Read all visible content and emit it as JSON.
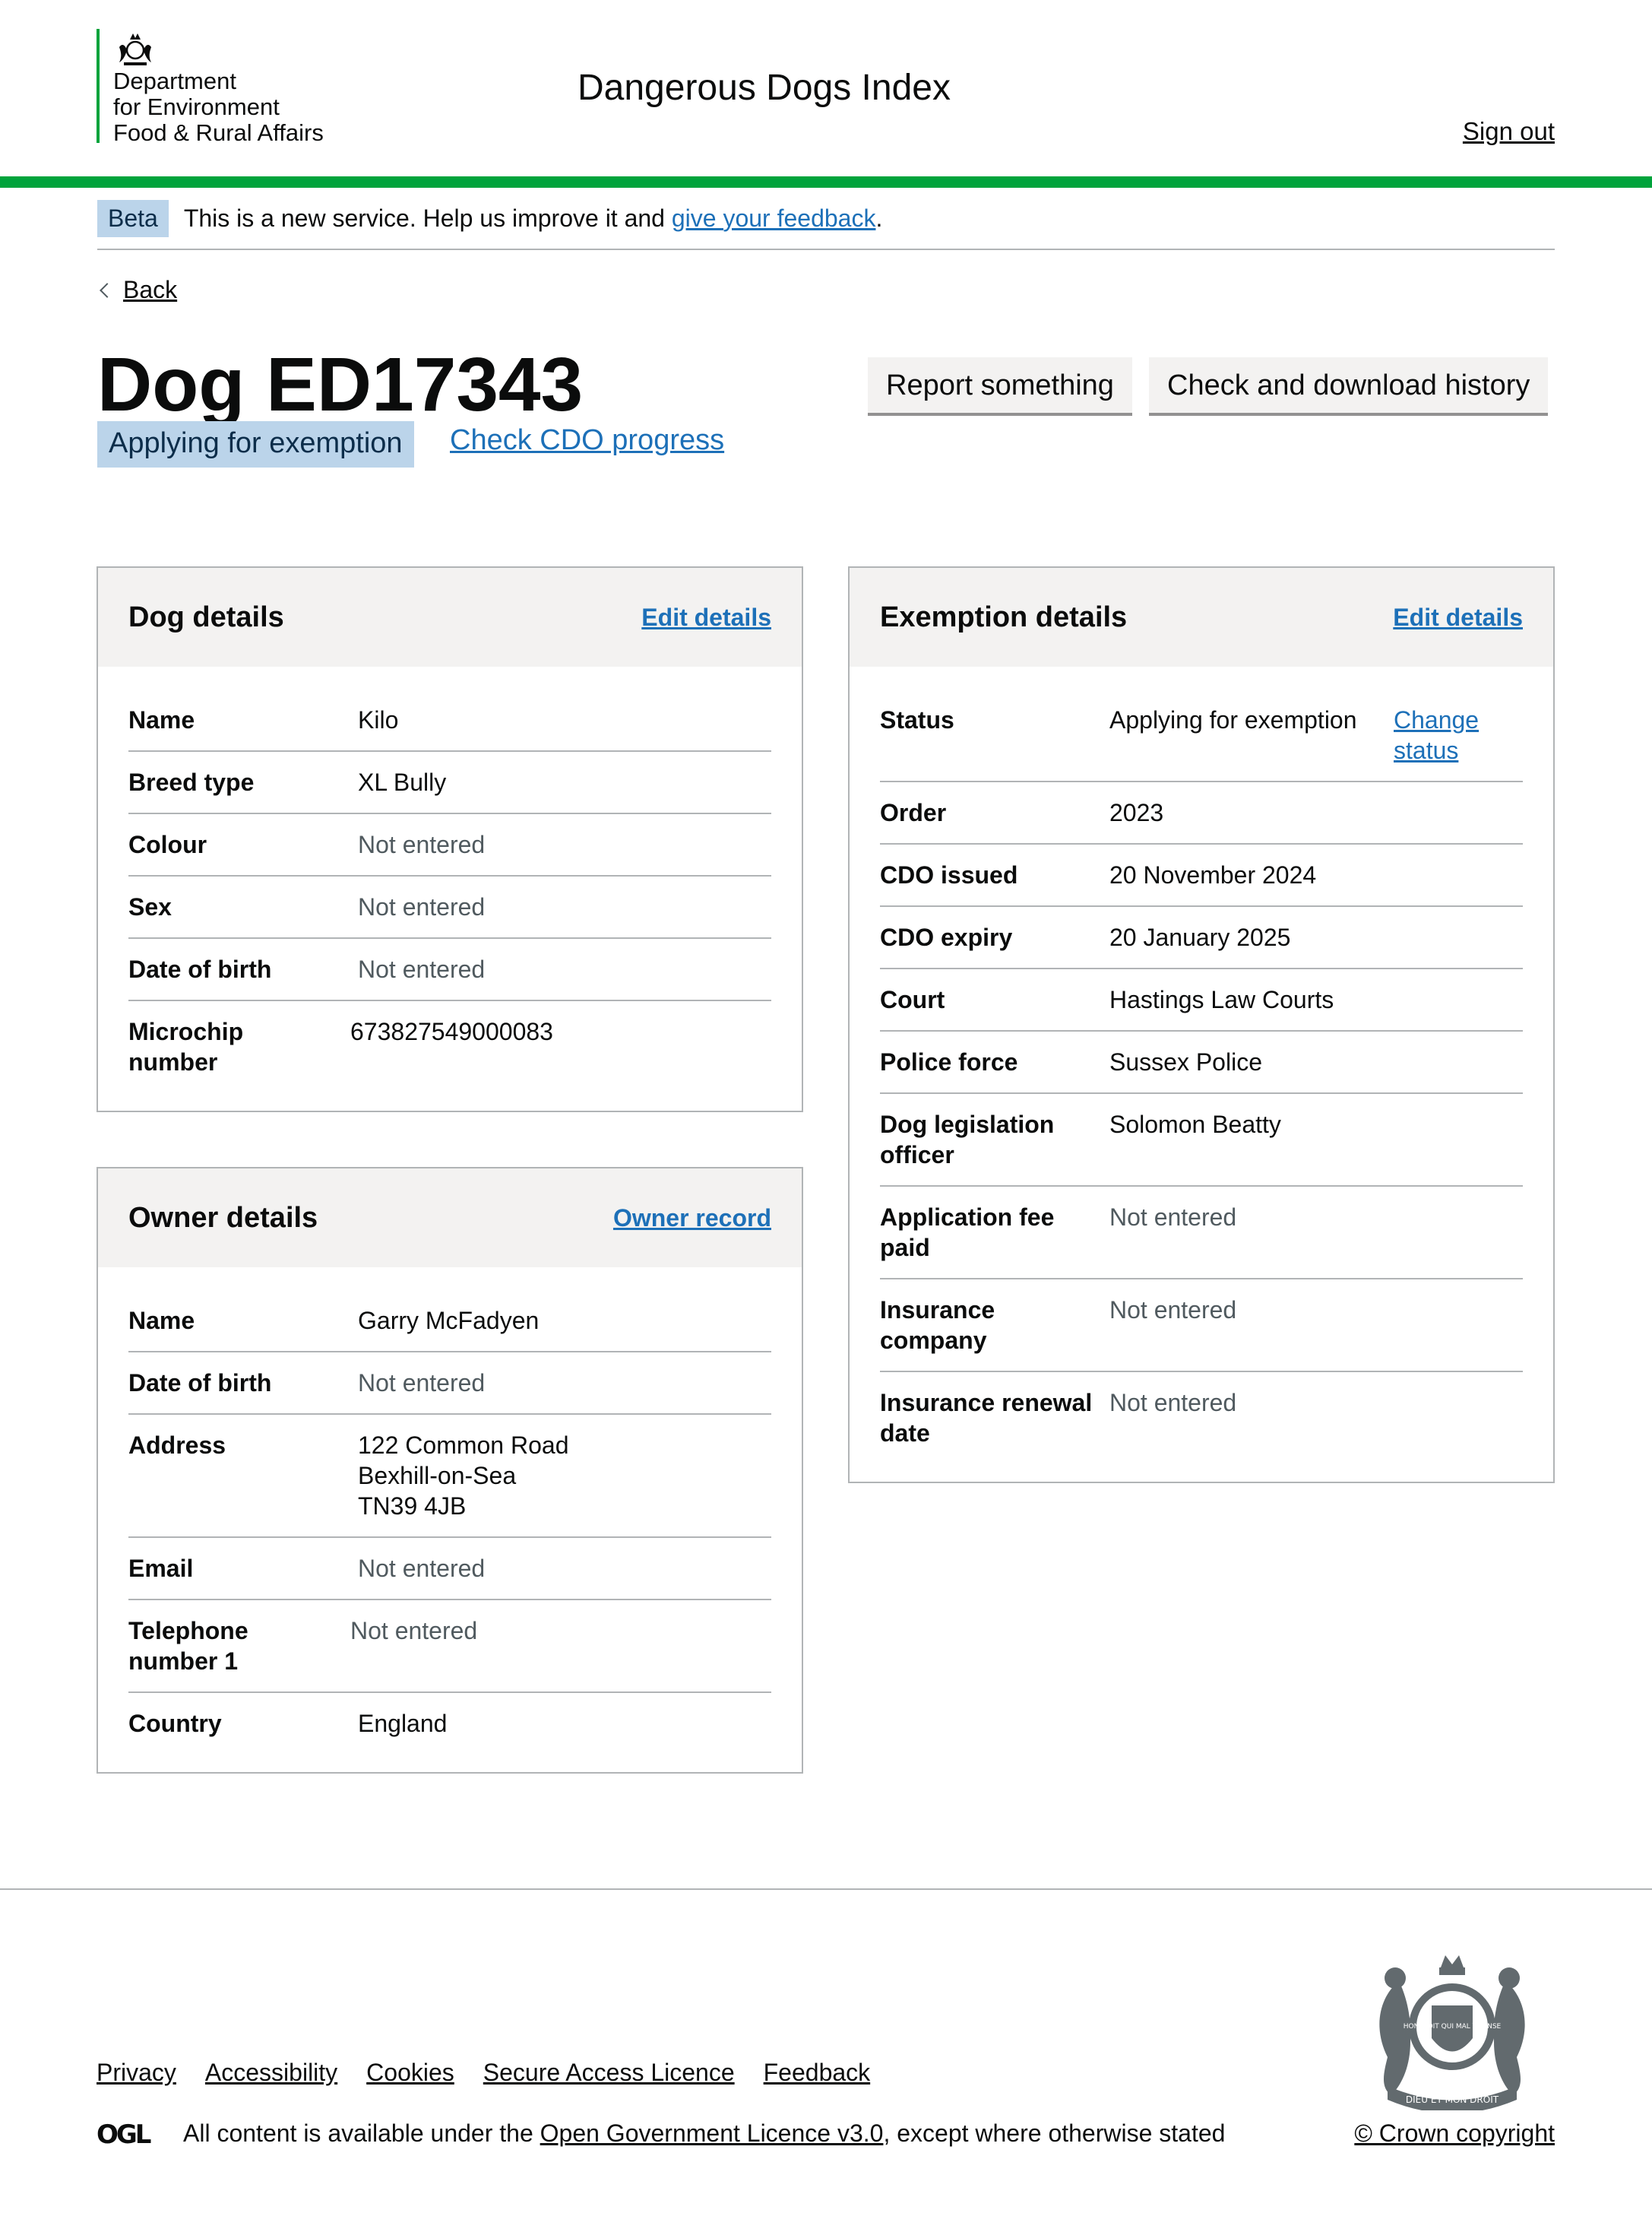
{
  "header": {
    "org_name_line1": "Department",
    "org_name_line2": "for Environment",
    "org_name_line3": "Food & Rural Affairs",
    "service_name": "Dangerous Dogs Index",
    "sign_out": "Sign out"
  },
  "beta": {
    "tag": "Beta",
    "text_before": "This is a new service. Help us improve it and ",
    "link": "give your feedback",
    "text_after": "."
  },
  "back_link": "Back",
  "page": {
    "title": "Dog ED17343",
    "status_tag": "Applying for exemption",
    "check_cdo_link": "Check CDO progress",
    "report_button": "Report something",
    "history_button": "Check and download history"
  },
  "dog_details": {
    "title": "Dog details",
    "action": "Edit details",
    "rows": [
      {
        "key": "Name",
        "value": "Kilo"
      },
      {
        "key": "Breed type",
        "value": "XL Bully"
      },
      {
        "key": "Colour",
        "value": "Not entered"
      },
      {
        "key": "Sex",
        "value": "Not entered"
      },
      {
        "key": "Date of birth",
        "value": "Not entered"
      },
      {
        "key": "Microchip number",
        "value": "673827549000083"
      }
    ]
  },
  "owner_details": {
    "title": "Owner details",
    "action": "Owner record",
    "rows": [
      {
        "key": "Name",
        "value": "Garry McFadyen"
      },
      {
        "key": "Date of birth",
        "value": "Not entered"
      },
      {
        "key": "Address",
        "value_lines": [
          "122 Common Road",
          "Bexhill-on-Sea",
          "TN39 4JB"
        ]
      },
      {
        "key": "Email",
        "value": "Not entered"
      },
      {
        "key": "Telephone number 1",
        "value": "Not entered"
      },
      {
        "key": "Country",
        "value": "England"
      }
    ]
  },
  "exemption_details": {
    "title": "Exemption details",
    "action": "Edit details",
    "rows": [
      {
        "key": "Status",
        "value": "Applying for exemption",
        "action": "Change status"
      },
      {
        "key": "Order",
        "value": "2023"
      },
      {
        "key": "CDO issued",
        "value": "20 November 2024"
      },
      {
        "key": "CDO expiry",
        "value": "20 January 2025"
      },
      {
        "key": "Court",
        "value": "Hastings Law Courts"
      },
      {
        "key": "Police force",
        "value": "Sussex Police"
      },
      {
        "key": "Dog legislation officer",
        "value": "Solomon Beatty"
      },
      {
        "key": "Application fee paid",
        "value": "Not entered"
      },
      {
        "key": "Insurance company",
        "value": "Not entered"
      },
      {
        "key": "Insurance renewal date",
        "value": "Not entered"
      }
    ]
  },
  "footer": {
    "links": [
      "Privacy",
      "Accessibility",
      "Cookies",
      "Secure Access Licence",
      "Feedback"
    ],
    "licence_before": "All content is available under the ",
    "licence_link": "Open Government Licence v3.0",
    "licence_after": ", except where otherwise stated",
    "copyright": "© Crown copyright",
    "crest_motto": "DIEU ET MON DROIT",
    "garter_motto": "HONI SOIT QUI MAL Y PENSE"
  },
  "icons": {
    "back": "chevron-left-icon",
    "ogl": "ogl-logo",
    "crest": "royal-coat-of-arms"
  },
  "colors": {
    "accent_green": "#00a33b",
    "link_blue": "#1d70b8",
    "tag_blue_bg": "#bbd4ea",
    "muted_text": "#505a5f"
  }
}
